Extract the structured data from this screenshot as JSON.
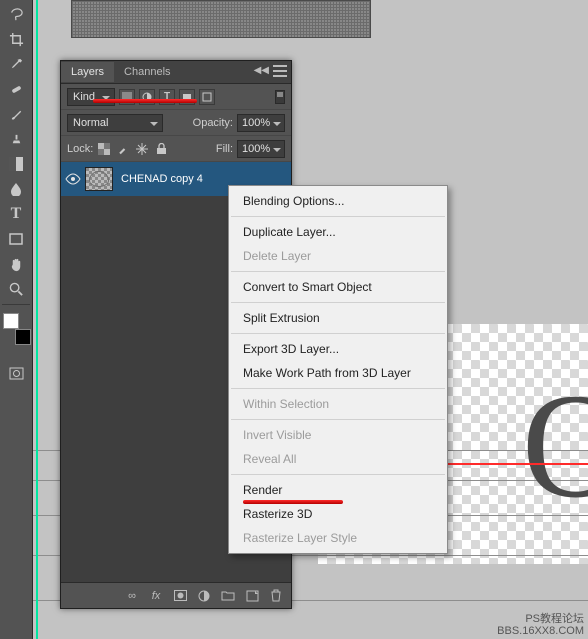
{
  "layers_panel": {
    "tabs": {
      "layers": "Layers",
      "channels": "Channels"
    },
    "filter_label": "Kind",
    "filter_icons": [
      "img",
      "adj",
      "T",
      "shape",
      "smart"
    ],
    "blend_mode": "Normal",
    "opacity_label": "Opacity:",
    "opacity_value": "100%",
    "lock_label": "Lock:",
    "fill_label": "Fill:",
    "fill_value": "100%",
    "layer": {
      "name": "CHENAD copy 4"
    }
  },
  "context_menu": {
    "items": [
      {
        "label": "Blending Options...",
        "enabled": true
      },
      {
        "sep": true
      },
      {
        "label": "Duplicate Layer...",
        "enabled": true
      },
      {
        "label": "Delete Layer",
        "enabled": false
      },
      {
        "sep": true
      },
      {
        "label": "Convert to Smart Object",
        "enabled": true
      },
      {
        "sep": true
      },
      {
        "label": "Split Extrusion",
        "enabled": true
      },
      {
        "sep": true
      },
      {
        "label": "Export 3D Layer...",
        "enabled": true
      },
      {
        "label": "Make Work Path from 3D Layer",
        "enabled": true
      },
      {
        "sep": true
      },
      {
        "label": "Within Selection",
        "enabled": false
      },
      {
        "sep": true
      },
      {
        "label": "Invert Visible",
        "enabled": false
      },
      {
        "label": "Reveal All",
        "enabled": false
      },
      {
        "sep": true
      },
      {
        "label": "Render",
        "enabled": true,
        "highlight": true
      },
      {
        "label": "Rasterize 3D",
        "enabled": true
      },
      {
        "label": "Rasterize Layer Style",
        "enabled": false
      }
    ]
  },
  "canvas": {
    "big_letter": "O"
  },
  "watermark": {
    "line1": "PS教程论坛",
    "line2": "BBS.16XX8.COM"
  }
}
